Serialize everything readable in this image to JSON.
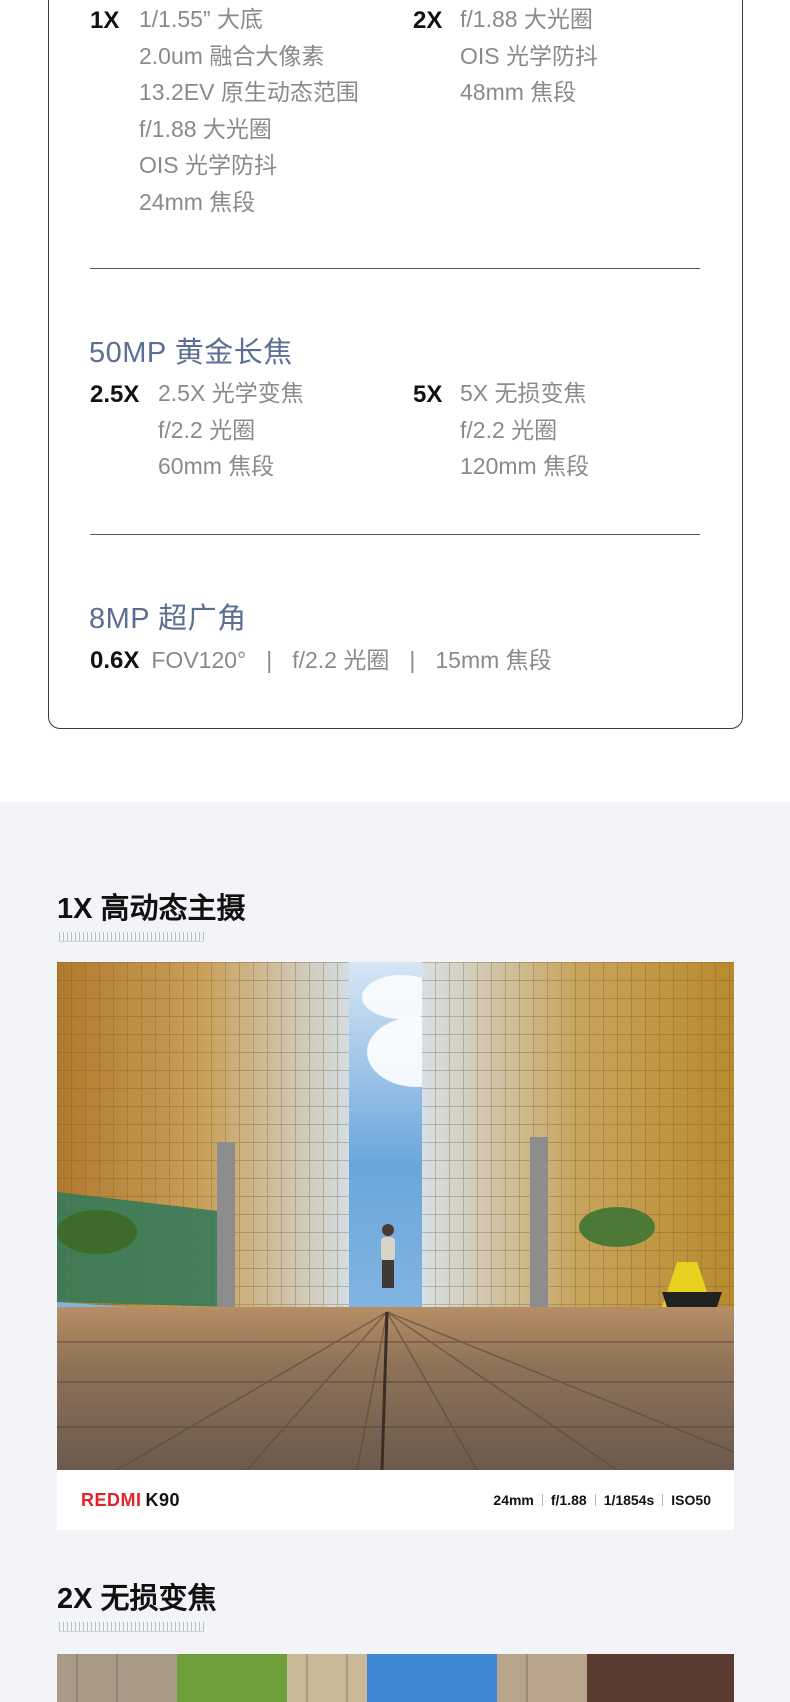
{
  "main_camera": {
    "left": {
      "zoom": "1X",
      "specs": [
        "1/1.55” 大底",
        "2.0um 融合大像素",
        "13.2EV 原生动态范围",
        "f/1.88 大光圈",
        "OIS 光学防抖",
        "24mm 焦段"
      ]
    },
    "right": {
      "zoom": "2X",
      "specs": [
        "f/1.88 大光圈",
        "OIS 光学防抖",
        "48mm 焦段"
      ]
    }
  },
  "telephoto": {
    "title": "50MP 黄金长焦",
    "left": {
      "zoom": "2.5X",
      "specs": [
        "2.5X 光学变焦",
        "f/2.2 光圈",
        "60mm 焦段"
      ]
    },
    "right": {
      "zoom": "5X",
      "specs": [
        "5X 无损变焦",
        "f/2.2 光圈",
        "120mm 焦段"
      ]
    }
  },
  "ultrawide": {
    "title": "8MP 超广角",
    "zoom": "0.6X",
    "specs": [
      "FOV120°",
      "f/2.2 光圈",
      "15mm 焦段"
    ],
    "separator": "|"
  },
  "gallery": {
    "section1": {
      "title": "1X 高动态主摄",
      "brand": "REDMI",
      "model": "K90",
      "exif": [
        "24mm",
        "f/1.88",
        "1/1854s",
        "ISO50"
      ]
    },
    "section2": {
      "title": "2X 无损变焦"
    }
  },
  "colors": {
    "accent_title": "#5a6f91",
    "brand_red": "#e3232b",
    "gallery_bg": "#f3f4f8"
  }
}
